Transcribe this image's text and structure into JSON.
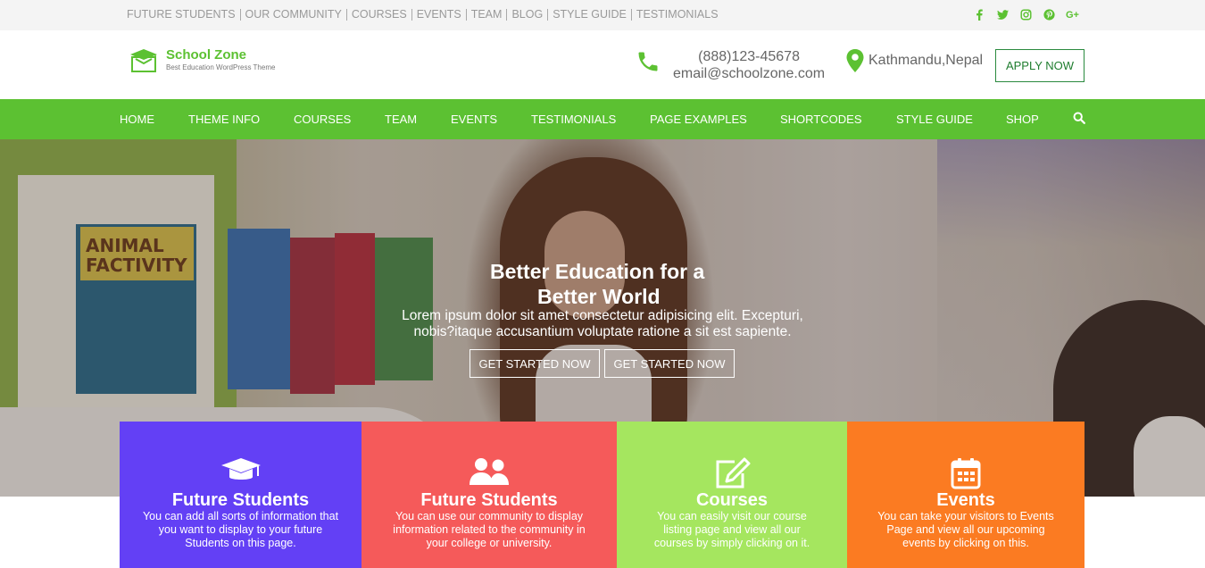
{
  "topbar": {
    "links": [
      "FUTURE STUDENTS",
      "OUR COMMUNITY",
      "COURSES",
      "EVENTS",
      "TEAM",
      "BLOG",
      "STYLE GUIDE",
      "TESTIMONIALS"
    ],
    "social_icons": [
      "facebook-icon",
      "twitter-icon",
      "instagram-icon",
      "pinterest-icon",
      "google-plus-icon"
    ],
    "google_plus_glyph": "G+"
  },
  "header": {
    "logo_title": "School Zone",
    "logo_subtitle": "Best Education WordPress Theme",
    "phone": "(888)123-45678",
    "email": "email@schoolzone.com",
    "location": "Kathmandu,Nepal",
    "apply_label": "APPLY NOW"
  },
  "nav": {
    "items": [
      "HOME",
      "THEME INFO",
      "COURSES",
      "TEAM",
      "EVENTS",
      "TESTIMONIALS",
      "PAGE EXAMPLES",
      "SHORTCODES",
      "STYLE GUIDE",
      "SHOP"
    ]
  },
  "hero": {
    "title_line1": "Better Education for a",
    "title_line2": "Better World",
    "subtitle": "Lorem ipsum dolor sit amet consectetur adipisicing elit. Excepturi, nobis?itaque accusantium voluptate ratione a sit est sapiente.",
    "button1": "GET STARTED NOW",
    "button2": "GET STARTED NOW",
    "box_label": "ANIMAL FACTIVITY"
  },
  "features": [
    {
      "title": "Future Students",
      "desc": "You can add all sorts of information that you want to display to your future Students on this page.",
      "icon": "graduation-cap-icon",
      "color": "#6340f5"
    },
    {
      "title": "Future Students",
      "desc": "You can use our community to display information related to the community in your college or university.",
      "icon": "users-icon",
      "color": "#f55a5a"
    },
    {
      "title": "Courses",
      "desc": "You can easily visit our course listing page and view all our courses by simply clicking on it.",
      "icon": "edit-icon",
      "color": "#a5e65f"
    },
    {
      "title": "Events",
      "desc": "You can take your visitors to Events Page and view all our upcoming events by clicking on this.",
      "icon": "calendar-icon",
      "color": "#fb7b22"
    }
  ],
  "colors": {
    "brand_green": "#5cc132",
    "apply_border": "#2a8a3e"
  }
}
